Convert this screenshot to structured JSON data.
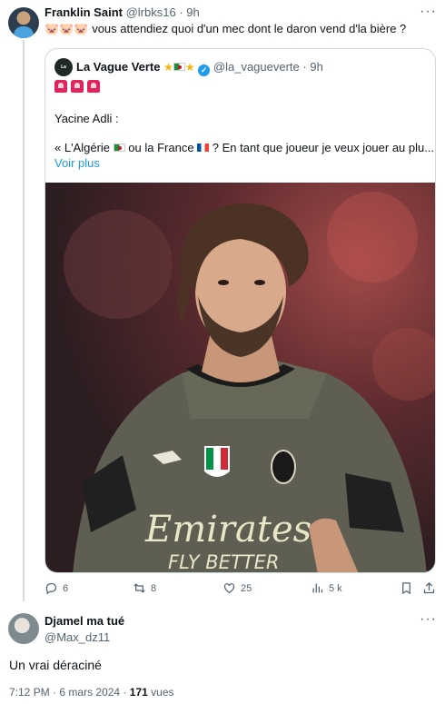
{
  "tweet": {
    "author_name": "Franklin Saint",
    "author_handle": "@lrbks16",
    "time": "9h",
    "emoji": "🐷🐷🐷",
    "text": "vous attendiez quoi d'un mec dont le daron vend d'la bière ?"
  },
  "quote": {
    "avatar_text": "La Vague",
    "author_name": "La Vague Verte",
    "author_handle": "@la_vagueverte",
    "time": "9h",
    "line1": "Yacine Adli :",
    "line2_a": "« L'Algérie",
    "line2_b": "ou la France",
    "line2_c": "? En tant que joueur je veux jouer au plu...",
    "show_more": "Voir plus",
    "photo": {
      "sponsor_line1": "Emirates",
      "sponsor_line2": "FLY BETTER"
    }
  },
  "actions": {
    "replies": "6",
    "retweets": "8",
    "likes": "25",
    "views": "5 k"
  },
  "reply": {
    "author_name": "Djamel ma tué",
    "author_handle": "@Max_dz11",
    "text": "Un vrai déraciné",
    "time": "7:12 PM",
    "date": "6 mars 2024",
    "views_count": "171",
    "views_label": "vues"
  },
  "icons": [
    "more-icon",
    "star-icon",
    "algeria-flag-icon",
    "verified-icon",
    "siren-icon",
    "reply-icon",
    "retweet-icon",
    "like-icon",
    "views-icon",
    "bookmark-icon",
    "share-icon"
  ],
  "colors": {
    "link": "#1d9bf0",
    "muted": "#536471",
    "text": "#0f1419",
    "border": "#cfd9de"
  }
}
